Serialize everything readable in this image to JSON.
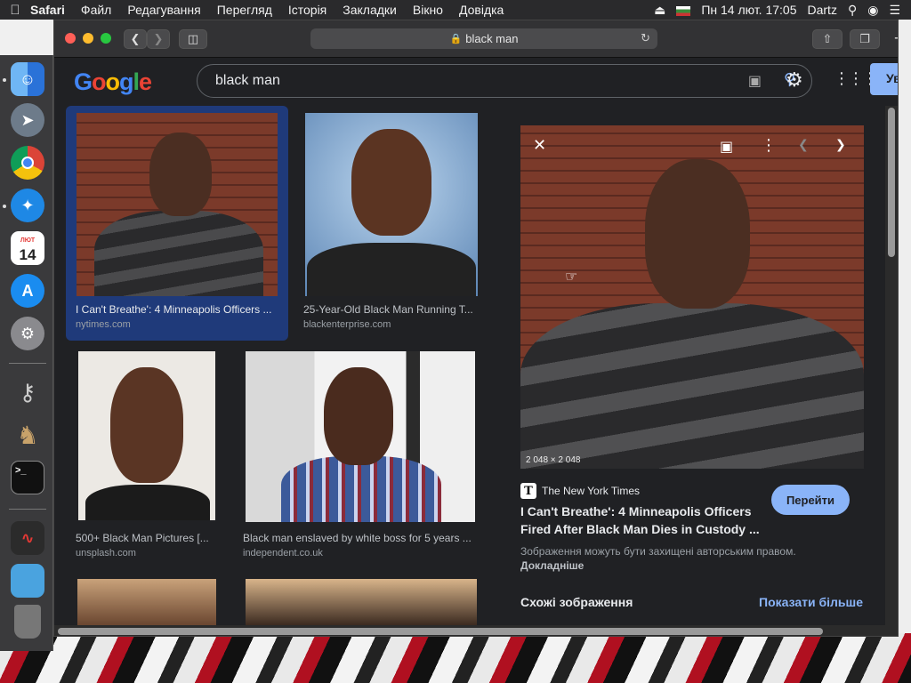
{
  "menubar": {
    "apple": "",
    "app_name": "Safari",
    "items": [
      "Файл",
      "Редагування",
      "Перегляд",
      "Історія",
      "Закладки",
      "Вікно",
      "Довідка"
    ],
    "date_time": "Пн 14 лют.  17:05",
    "user": "Dartz"
  },
  "browser": {
    "url_text": "black man"
  },
  "google": {
    "logo_text": "Google",
    "query": "black man",
    "signin_label": "Ув"
  },
  "results": [
    {
      "title": "I Can't Breathe': 4 Minneapolis Officers ...",
      "source": "nytimes.com",
      "selected": true
    },
    {
      "title": "25-Year-Old Black Man Running T...",
      "source": "blackenterprise.com"
    },
    {
      "title": "500+ Black Man Pictures [...",
      "source": "unsplash.com"
    },
    {
      "title": "Black man enslaved by white boss for 5 years ...",
      "source": "independent.co.uk"
    }
  ],
  "preview": {
    "dimensions": "2 048 × 2 048",
    "source_name": "The New York Times",
    "title": "I Can't Breathe': 4 Minneapolis Officers Fired After Black Man Dies in Custody ...",
    "visit_label": "Перейти",
    "copyright_text": "Зображення можуть бути захищені авторським правом.",
    "learn_more": "Докладніше",
    "similar_heading": "Схожі зображення",
    "show_more": "Показати більше"
  },
  "dock": {
    "calendar_month": "ЛЮТ",
    "calendar_day": "14"
  },
  "colors": {
    "accent": "#8ab4f8",
    "selected_card": "#1f3a7a",
    "background": "#202124"
  }
}
